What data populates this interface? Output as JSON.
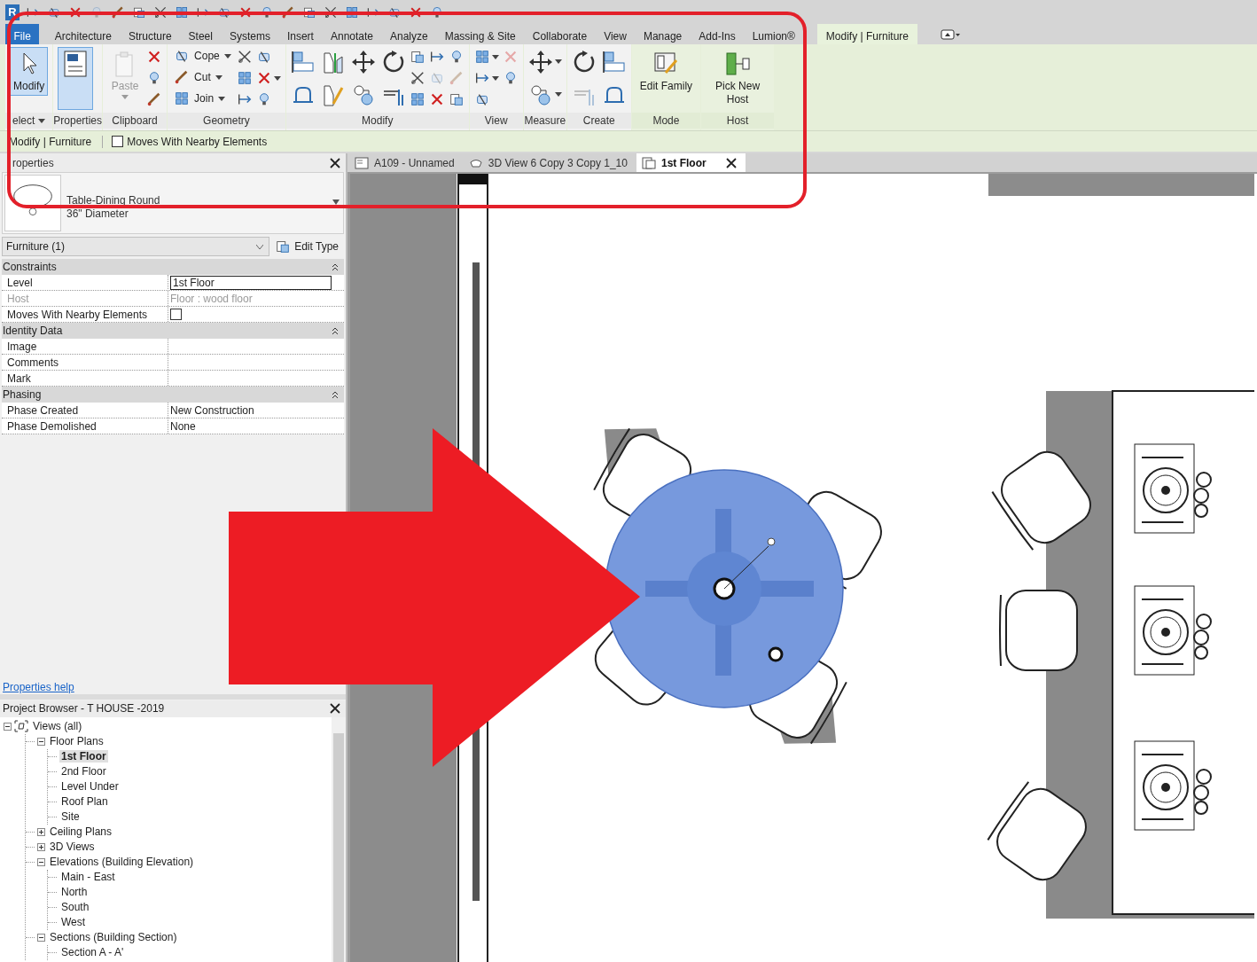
{
  "app_logo": "R",
  "ribbon_tabs": [
    {
      "label": "File",
      "kind": "file",
      "selected": false
    },
    {
      "label": "Architecture",
      "kind": "tab",
      "selected": false
    },
    {
      "label": "Structure",
      "kind": "tab",
      "selected": false
    },
    {
      "label": "Steel",
      "kind": "tab",
      "selected": false
    },
    {
      "label": "Systems",
      "kind": "tab",
      "selected": false
    },
    {
      "label": "Insert",
      "kind": "tab",
      "selected": false
    },
    {
      "label": "Annotate",
      "kind": "tab",
      "selected": false
    },
    {
      "label": "Analyze",
      "kind": "tab",
      "selected": false
    },
    {
      "label": "Massing & Site",
      "kind": "tab",
      "selected": false
    },
    {
      "label": "Collaborate",
      "kind": "tab",
      "selected": false
    },
    {
      "label": "View",
      "kind": "tab",
      "selected": false
    },
    {
      "label": "Manage",
      "kind": "tab",
      "selected": false
    },
    {
      "label": "Add-Ins",
      "kind": "tab",
      "selected": false
    },
    {
      "label": "Lumion®",
      "kind": "tab",
      "selected": false
    },
    {
      "label": "Modify | Furniture",
      "kind": "context",
      "selected": true
    }
  ],
  "ribbon_panels": [
    {
      "title": "elect",
      "has_menu": true,
      "contextual": false,
      "tools": [
        {
          "kind": "large",
          "label": "Modify",
          "selected": true,
          "disabled": false,
          "has_menu": false
        }
      ]
    },
    {
      "title": "Properties",
      "contextual": false,
      "tools": [
        {
          "kind": "large",
          "selected": true,
          "disabled": false
        }
      ]
    },
    {
      "title": "Clipboard",
      "contextual": false,
      "tools": [
        {
          "kind": "large",
          "label": "Paste",
          "selected": false,
          "disabled": true,
          "has_menu": true
        },
        {
          "kind": "icon",
          "disabled": false
        },
        {
          "kind": "icon",
          "disabled": false
        },
        {
          "kind": "icon",
          "disabled": false
        }
      ]
    },
    {
      "title": "Geometry",
      "contextual": false,
      "tools": [
        {
          "kind": "small",
          "label": "Cope",
          "disabled": false,
          "has_menu": true
        },
        {
          "kind": "small",
          "label": "Cut",
          "disabled": false,
          "has_menu": true
        },
        {
          "kind": "small",
          "label": "Join",
          "disabled": false,
          "has_menu": true
        },
        {
          "kind": "icon",
          "disabled": false
        },
        {
          "kind": "icon",
          "disabled": false
        },
        {
          "kind": "icon",
          "disabled": false
        },
        {
          "kind": "icon",
          "disabled": false
        },
        {
          "kind": "icon",
          "disabled": false,
          "has_menu": true
        },
        {
          "kind": "icon",
          "disabled": false
        }
      ]
    },
    {
      "title": "Modify",
      "contextual": false,
      "tools": [
        {
          "kind": "tile",
          "disabled": false
        },
        {
          "kind": "tile",
          "disabled": false
        },
        {
          "kind": "tile",
          "disabled": false
        },
        {
          "kind": "tile",
          "disabled": false
        },
        {
          "kind": "tile",
          "disabled": false
        },
        {
          "kind": "tile",
          "disabled": false
        },
        {
          "kind": "tile",
          "disabled": false
        },
        {
          "kind": "tile",
          "disabled": false
        },
        {
          "kind": "icon",
          "disabled": false
        },
        {
          "kind": "icon",
          "disabled": false
        },
        {
          "kind": "icon",
          "disabled": false
        },
        {
          "kind": "icon",
          "disabled": false
        },
        {
          "kind": "icon",
          "disabled": true
        },
        {
          "kind": "icon",
          "disabled": false
        },
        {
          "kind": "icon",
          "disabled": false
        },
        {
          "kind": "icon",
          "disabled": true
        },
        {
          "kind": "icon",
          "disabled": false
        }
      ]
    },
    {
      "title": "View",
      "contextual": false,
      "tools": [
        {
          "kind": "icon",
          "disabled": false,
          "has_menu": true
        },
        {
          "kind": "icon",
          "disabled": false,
          "has_menu": true
        },
        {
          "kind": "icon",
          "disabled": false
        },
        {
          "kind": "icon",
          "disabled": true
        },
        {
          "kind": "icon",
          "disabled": false
        }
      ]
    },
    {
      "title": "Measure",
      "contextual": false,
      "tools": [
        {
          "kind": "tile",
          "disabled": false,
          "has_menu": true
        },
        {
          "kind": "tile",
          "disabled": false,
          "has_menu": true
        }
      ]
    },
    {
      "title": "Create",
      "contextual": false,
      "tools": [
        {
          "kind": "tile",
          "disabled": false
        },
        {
          "kind": "tile",
          "disabled": true
        },
        {
          "kind": "tile",
          "disabled": false
        },
        {
          "kind": "tile",
          "disabled": false
        }
      ]
    },
    {
      "title": "Mode",
      "contextual": true,
      "tools": [
        {
          "kind": "large",
          "label": "Edit Family",
          "selected": false,
          "disabled": false
        }
      ]
    },
    {
      "title": "Host",
      "contextual": true,
      "tools": [
        {
          "kind": "large",
          "label": "Pick New Host",
          "selected": false,
          "disabled": false
        }
      ]
    }
  ],
  "options_bar": {
    "context": "Modify | Furniture",
    "checkbox": {
      "label": "Moves With Nearby Elements",
      "checked": false
    }
  },
  "properties": {
    "title": "roperties",
    "type_name": "Table-Dining Round",
    "type_size": "36\" Diameter",
    "filter": "Furniture (1)",
    "edit_type": "Edit Type",
    "groups": [
      {
        "title": "Constraints",
        "expanded": true,
        "rows": [
          {
            "label": "Level",
            "value": "1st Floor",
            "kind": "field",
            "disabled": false
          },
          {
            "label": "Host",
            "value": "Floor : wood floor",
            "kind": "text",
            "disabled": true
          },
          {
            "label": "Moves With Nearby Elements",
            "kind": "checkbox",
            "checked": false,
            "disabled": false
          }
        ]
      },
      {
        "title": "Identity Data",
        "expanded": true,
        "rows": [
          {
            "label": "Image",
            "kind": "text",
            "disabled": false
          },
          {
            "label": "Comments",
            "kind": "text",
            "disabled": false
          },
          {
            "label": "Mark",
            "kind": "text",
            "disabled": false
          }
        ]
      },
      {
        "title": "Phasing",
        "expanded": true,
        "rows": [
          {
            "label": "Phase Created",
            "value": "New Construction",
            "kind": "text",
            "disabled": false
          },
          {
            "label": "Phase Demolished",
            "value": "None",
            "kind": "text",
            "disabled": false
          }
        ]
      }
    ],
    "help_link": "Properties help"
  },
  "project_browser": {
    "title": "Project Browser - T HOUSE -2019",
    "tree": [
      {
        "label": "Views (all)",
        "kind": "root",
        "expanded": true,
        "selected": false,
        "children": [
          {
            "label": "Floor Plans",
            "expanded": true,
            "selected": false,
            "children": [
              {
                "label": "1st Floor",
                "selected": true
              },
              {
                "label": "2nd Floor",
                "selected": false
              },
              {
                "label": "Level Under",
                "selected": false
              },
              {
                "label": "Roof Plan",
                "selected": false
              },
              {
                "label": "Site",
                "selected": false
              }
            ]
          },
          {
            "label": "Ceiling Plans",
            "expanded": false,
            "selected": false
          },
          {
            "label": "3D Views",
            "expanded": false,
            "selected": false
          },
          {
            "label": "Elevations (Building Elevation)",
            "expanded": true,
            "selected": false,
            "children": [
              {
                "label": "Main - East",
                "selected": false
              },
              {
                "label": "North",
                "selected": false
              },
              {
                "label": "South",
                "selected": false
              },
              {
                "label": "West",
                "selected": false
              }
            ]
          },
          {
            "label": "Sections (Building Section)",
            "expanded": true,
            "selected": false,
            "children": [
              {
                "label": "Section A - A'",
                "selected": false
              }
            ]
          }
        ]
      }
    ]
  },
  "view_tabs": [
    {
      "label": "A109 - Unnamed",
      "kind": "sheet",
      "selected": false
    },
    {
      "label": "3D View 6 Copy 3 Copy 1_10",
      "kind": "model",
      "selected": false
    },
    {
      "label": "1st Floor",
      "kind": "plan",
      "selected": true
    }
  ]
}
